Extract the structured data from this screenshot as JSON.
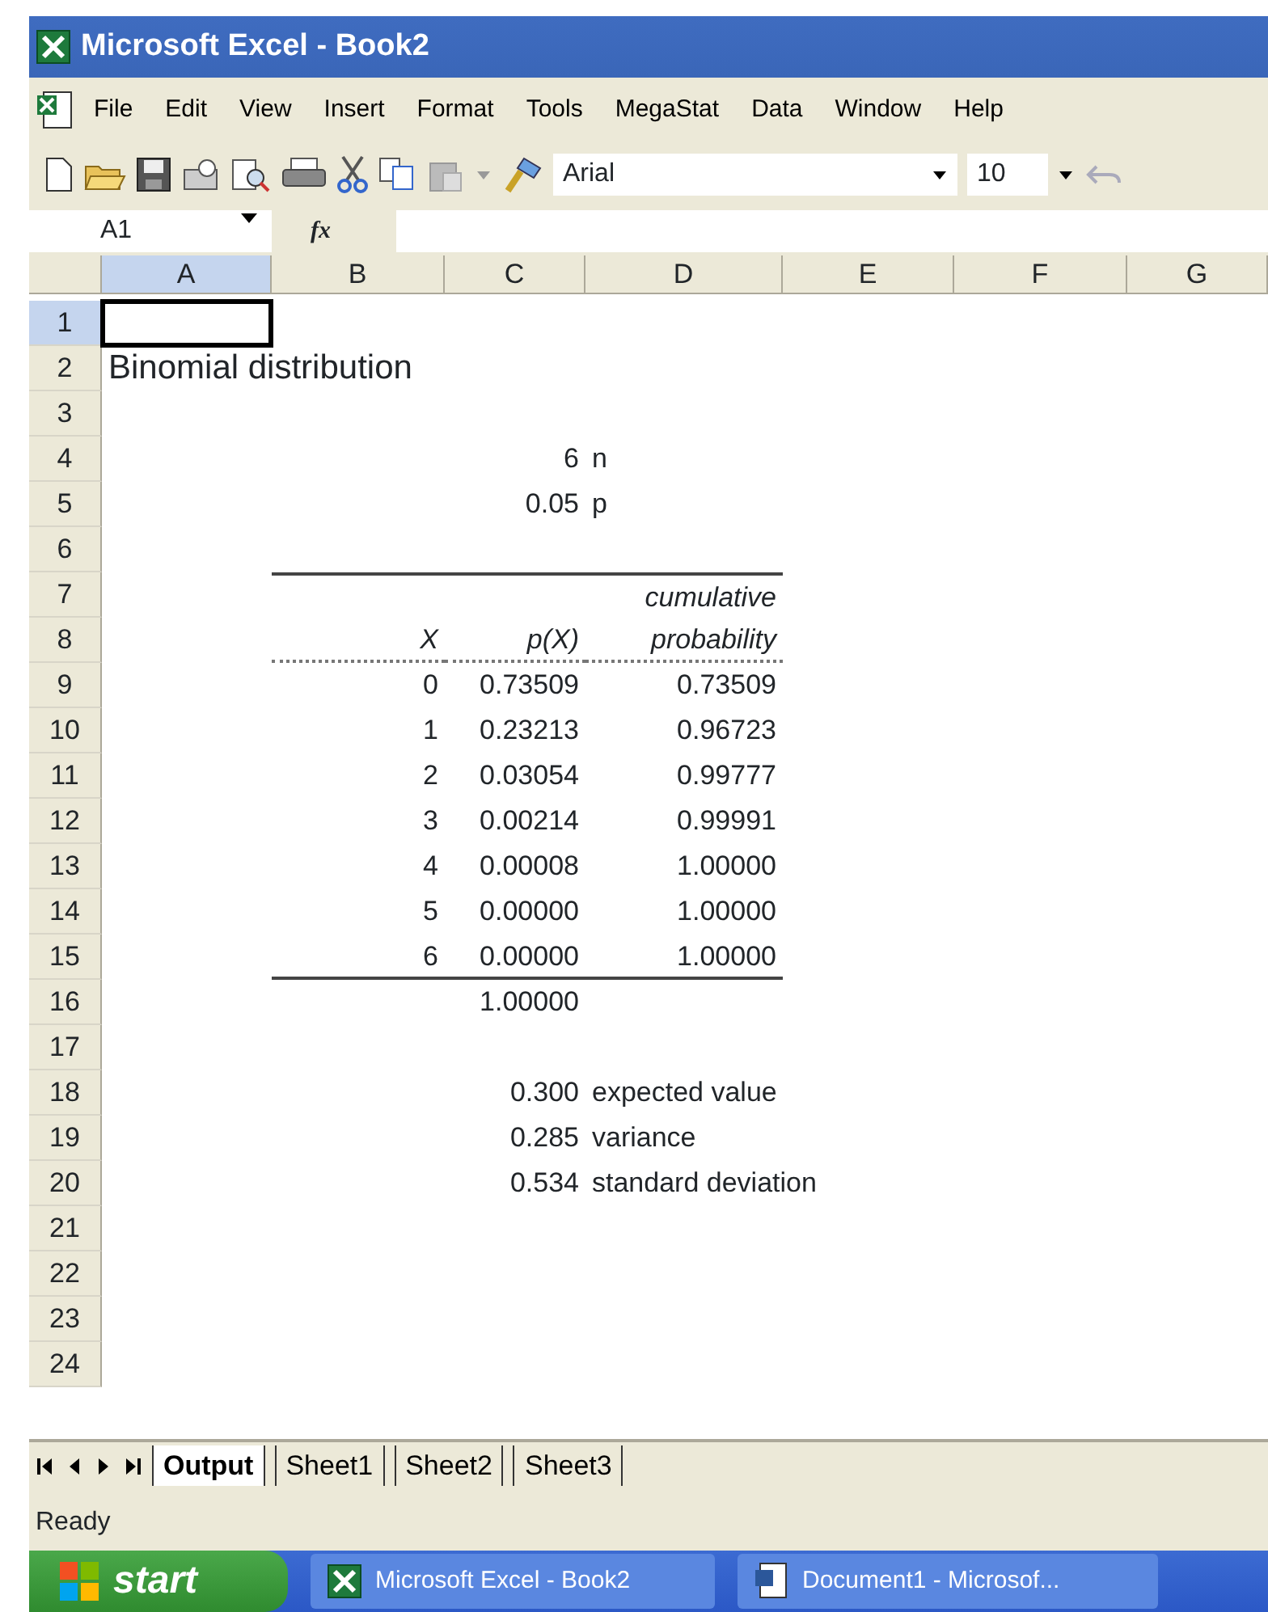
{
  "window": {
    "title": "Microsoft Excel - Book2"
  },
  "menu": [
    "File",
    "Edit",
    "View",
    "Insert",
    "Format",
    "Tools",
    "MegaStat",
    "Data",
    "Window",
    "Help"
  ],
  "toolbar": {
    "font": "Arial",
    "size": "10"
  },
  "formula_bar": {
    "name_box": "A1",
    "fx": "fx"
  },
  "columns": [
    {
      "label": "A",
      "selected": true
    },
    {
      "label": "B",
      "selected": false
    },
    {
      "label": "C",
      "selected": false
    },
    {
      "label": "D",
      "selected": false
    },
    {
      "label": "E",
      "selected": false
    },
    {
      "label": "F",
      "selected": false
    },
    {
      "label": "G",
      "selected": false
    }
  ],
  "rows": [
    {
      "number": "1",
      "selected": true,
      "kind": "plain",
      "cells": {
        "A": {
          "kind": "empty",
          "selected": true
        }
      }
    },
    {
      "number": "2",
      "selected": false,
      "kind": "plain",
      "cells": {
        "A": {
          "text": "Binomial distribution",
          "kind": "title"
        }
      }
    },
    {
      "number": "3",
      "selected": false,
      "kind": "plain",
      "cells": {}
    },
    {
      "number": "4",
      "selected": false,
      "kind": "plain",
      "cells": {
        "C": {
          "text": "6",
          "kind": "number"
        },
        "D": {
          "text": "n",
          "kind": "label"
        }
      }
    },
    {
      "number": "5",
      "selected": false,
      "kind": "plain",
      "cells": {
        "C": {
          "text": "0.05",
          "kind": "number"
        },
        "D": {
          "text": "p",
          "kind": "label"
        }
      }
    },
    {
      "number": "6",
      "selected": false,
      "kind": "plain",
      "cells": {}
    },
    {
      "number": "7",
      "selected": false,
      "kind": "rule_above",
      "cells": {
        "D": {
          "text": "cumulative",
          "kind": "heading"
        }
      }
    },
    {
      "number": "8",
      "selected": false,
      "kind": "dotted_below",
      "cells": {
        "B": {
          "text": "X",
          "kind": "heading"
        },
        "C": {
          "text": "p(X)",
          "kind": "heading"
        },
        "D": {
          "text": "probability",
          "kind": "heading"
        }
      }
    },
    {
      "number": "9",
      "selected": false,
      "kind": "plain",
      "cells": {
        "B": {
          "text": "0",
          "kind": "number"
        },
        "C": {
          "text": "0.73509",
          "kind": "number"
        },
        "D": {
          "text": "0.73509",
          "kind": "number"
        }
      }
    },
    {
      "number": "10",
      "selected": false,
      "kind": "plain",
      "cells": {
        "B": {
          "text": "1",
          "kind": "number"
        },
        "C": {
          "text": "0.23213",
          "kind": "number"
        },
        "D": {
          "text": "0.96723",
          "kind": "number"
        }
      }
    },
    {
      "number": "11",
      "selected": false,
      "kind": "plain",
      "cells": {
        "B": {
          "text": "2",
          "kind": "number"
        },
        "C": {
          "text": "0.03054",
          "kind": "number"
        },
        "D": {
          "text": "0.99777",
          "kind": "number"
        }
      }
    },
    {
      "number": "12",
      "selected": false,
      "kind": "plain",
      "cells": {
        "B": {
          "text": "3",
          "kind": "number"
        },
        "C": {
          "text": "0.00214",
          "kind": "number"
        },
        "D": {
          "text": "0.99991",
          "kind": "number"
        }
      }
    },
    {
      "number": "13",
      "selected": false,
      "kind": "plain",
      "cells": {
        "B": {
          "text": "4",
          "kind": "number"
        },
        "C": {
          "text": "0.00008",
          "kind": "number"
        },
        "D": {
          "text": "1.00000",
          "kind": "number"
        }
      }
    },
    {
      "number": "14",
      "selected": false,
      "kind": "plain",
      "cells": {
        "B": {
          "text": "5",
          "kind": "number"
        },
        "C": {
          "text": "0.00000",
          "kind": "number"
        },
        "D": {
          "text": "1.00000",
          "kind": "number"
        }
      }
    },
    {
      "number": "15",
      "selected": false,
      "kind": "solid_below",
      "cells": {
        "B": {
          "text": "6",
          "kind": "number"
        },
        "C": {
          "text": "0.00000",
          "kind": "number"
        },
        "D": {
          "text": "1.00000",
          "kind": "number"
        }
      }
    },
    {
      "number": "16",
      "selected": false,
      "kind": "plain",
      "cells": {
        "C": {
          "text": "1.00000",
          "kind": "number"
        }
      }
    },
    {
      "number": "17",
      "selected": false,
      "kind": "plain",
      "cells": {}
    },
    {
      "number": "18",
      "selected": false,
      "kind": "plain",
      "cells": {
        "C": {
          "text": "0.300",
          "kind": "number"
        },
        "D": {
          "text": "expected value",
          "kind": "label"
        }
      }
    },
    {
      "number": "19",
      "selected": false,
      "kind": "plain",
      "cells": {
        "C": {
          "text": "0.285",
          "kind": "number"
        },
        "D": {
          "text": "variance",
          "kind": "label"
        }
      }
    },
    {
      "number": "20",
      "selected": false,
      "kind": "plain",
      "cells": {
        "C": {
          "text": "0.534",
          "kind": "number"
        },
        "D": {
          "text": "standard deviation",
          "kind": "label"
        }
      }
    },
    {
      "number": "21",
      "selected": false,
      "kind": "plain",
      "cells": {}
    },
    {
      "number": "22",
      "selected": false,
      "kind": "plain",
      "cells": {}
    },
    {
      "number": "23",
      "selected": false,
      "kind": "plain",
      "cells": {}
    },
    {
      "number": "24",
      "selected": false,
      "kind": "plain",
      "cells": {}
    }
  ],
  "sheet_tabs": [
    {
      "label": "Output",
      "selected": true
    },
    {
      "label": "Sheet1",
      "selected": false
    },
    {
      "label": "Sheet2",
      "selected": false
    },
    {
      "label": "Sheet3",
      "selected": false
    }
  ],
  "status_bar": "Ready",
  "taskbar": {
    "start": "start",
    "tasks": [
      {
        "label": "Microsoft Excel - Book2",
        "kind": "excel"
      },
      {
        "label": "Document1 - Microsof...",
        "kind": "word"
      }
    ]
  }
}
